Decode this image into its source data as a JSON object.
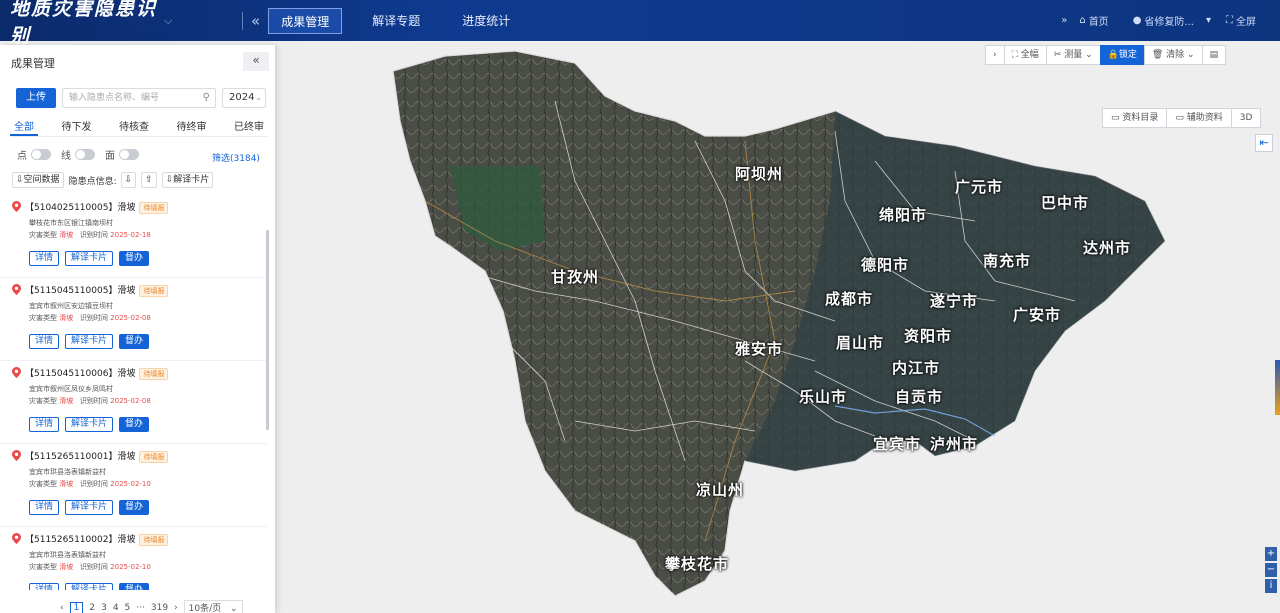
{
  "header": {
    "app_title": "地质灾害隐患识别",
    "nav": [
      "成果管理",
      "解译专题",
      "进度统计"
    ],
    "home": "首页",
    "user": "省修复防...",
    "fullscreen": "全屏"
  },
  "map_toolbar": {
    "fit": "全幅",
    "measure": "测量",
    "lock": "锁定",
    "clear": "清除"
  },
  "map_tools2": [
    "资料目录",
    "辅助资料",
    "3D"
  ],
  "map_labels": [
    "阿坝州",
    "广元市",
    "巴中市",
    "绵阳市",
    "德阳市",
    "南充市",
    "达州市",
    "甘孜州",
    "成都市",
    "遂宁市",
    "广安市",
    "雅安市",
    "眉山市",
    "资阳市",
    "内江市",
    "乐山市",
    "自贡市",
    "宜宾市",
    "泸州市",
    "凉山州",
    "攀枝花市"
  ],
  "panel": {
    "title": "成果管理",
    "upload": "上传",
    "search_placeholder": "输入隐患点名称、编号",
    "year": "2024",
    "tabs": [
      "全部",
      "待下发",
      "待核查",
      "待终审",
      "已终审"
    ],
    "toggles": [
      "点",
      "线",
      "面"
    ],
    "filter": "筛选(3184)",
    "spatial": "空间数据",
    "hazard_info": "隐患点信息:",
    "card": "解译卡片"
  },
  "items": [
    {
      "id": "【5104025110005】滑坡",
      "status": "待填报",
      "addr": "攀枝花市东区银江镇南坝村",
      "type_label": "灾害类型",
      "type": "滑坡",
      "time_label": "识别时间",
      "time": "2025-02-18"
    },
    {
      "id": "【5115045110005】滑坡",
      "status": "待填报",
      "addr": "宜宾市叙州区安边镇豆坝村",
      "type_label": "灾害类型",
      "type": "滑坡",
      "time_label": "识别时间",
      "time": "2025-02-08"
    },
    {
      "id": "【5115045110006】滑坡",
      "status": "待填报",
      "addr": "宜宾市叙州区凤仪乡凤鸣村",
      "type_label": "灾害类型",
      "type": "滑坡",
      "time_label": "识别时间",
      "time": "2025-02-08"
    },
    {
      "id": "【5115265110001】滑坡",
      "status": "待填报",
      "addr": "宜宾市珙县洛表镇新益村",
      "type_label": "灾害类型",
      "type": "滑坡",
      "time_label": "识别时间",
      "time": "2025-02-10"
    },
    {
      "id": "【5115265110002】滑坡",
      "status": "待填报",
      "addr": "宜宾市珙县洛表镇新益村",
      "type_label": "灾害类型",
      "type": "滑坡",
      "time_label": "识别时间",
      "time": "2025-02-10"
    }
  ],
  "item_buttons": {
    "detail": "详情",
    "card": "解译卡片",
    "supervise": "督办"
  },
  "pager": {
    "pages": [
      "1",
      "2",
      "3",
      "4",
      "5"
    ],
    "ellipsis": "···",
    "last": "319",
    "size": "10条/页"
  },
  "colors": {
    "header": "#0d3580",
    "accent": "#1464d8",
    "status": "#e8872b"
  }
}
